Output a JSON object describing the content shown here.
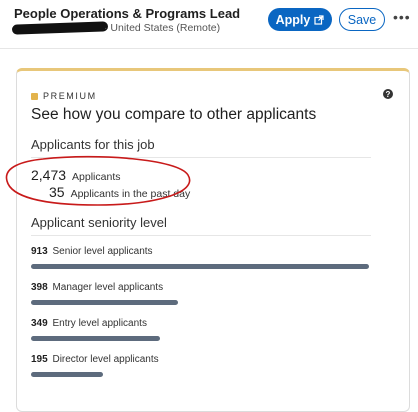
{
  "header": {
    "job_title": "People Operations & Programs Lead",
    "location": "· United States (Remote)",
    "apply_label": "Apply",
    "save_label": "Save",
    "more_label": "•••"
  },
  "card": {
    "premium_label": "PREMIUM",
    "help_label": "?",
    "heading": "See how you compare to other applicants",
    "applicants_section_title": "Applicants for this job",
    "applicants": [
      {
        "value": "2,473",
        "label": "Applicants"
      },
      {
        "value": "35",
        "label": "Applicants in the past day"
      }
    ],
    "seniority_section_title": "Applicant seniority level",
    "seniority": [
      {
        "count": "913",
        "label": "Senior level applicants",
        "share": 1.0
      },
      {
        "count": "398",
        "label": "Manager level applicants",
        "share": 0.436
      },
      {
        "count": "349",
        "label": "Entry level applicants",
        "share": 0.382
      },
      {
        "count": "195",
        "label": "Director level applicants",
        "share": 0.214
      }
    ]
  },
  "colors": {
    "accent": "#0a66c2",
    "premium_gold": "#e3b34c",
    "bar": "#5d6b7d",
    "annotation": "#c81a1a"
  }
}
